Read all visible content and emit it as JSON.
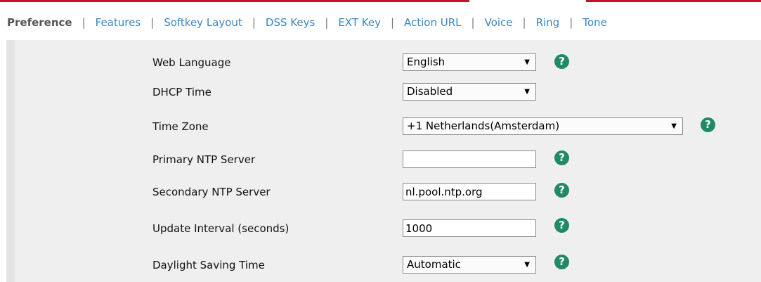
{
  "tabs": [
    {
      "label": "Preference",
      "active": true
    },
    {
      "label": "Features",
      "active": false
    },
    {
      "label": "Softkey Layout",
      "active": false
    },
    {
      "label": "DSS Keys",
      "active": false
    },
    {
      "label": "EXT Key",
      "active": false
    },
    {
      "label": "Action URL",
      "active": false
    },
    {
      "label": "Voice",
      "active": false
    },
    {
      "label": "Ring",
      "active": false
    },
    {
      "label": "Tone",
      "active": false
    }
  ],
  "tab_separator": "|",
  "help_glyph": "?",
  "dropdown_caret": "▼",
  "colors": {
    "accent_red": "#c8102e",
    "tab_link": "#3a86c2",
    "help_icon": "#1f8a64",
    "panel_bg": "#efefef"
  },
  "settings": {
    "web_language": {
      "label": "Web Language",
      "value": "English"
    },
    "dhcp_time": {
      "label": "DHCP Time",
      "value": "Disabled"
    },
    "time_zone": {
      "label": "Time Zone",
      "value": "+1 Netherlands(Amsterdam)"
    },
    "primary_ntp": {
      "label": "Primary NTP Server",
      "value": ""
    },
    "secondary_ntp": {
      "label": "Secondary NTP Server",
      "value": "nl.pool.ntp.org"
    },
    "update_interval": {
      "label": "Update Interval (seconds)",
      "value": "1000"
    },
    "daylight_saving": {
      "label": "Daylight Saving Time",
      "value": "Automatic"
    }
  }
}
